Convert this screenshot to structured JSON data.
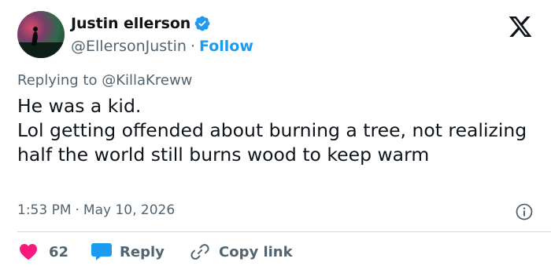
{
  "author": {
    "display_name": "Justin ellerson",
    "handle": "@EllersonJustin",
    "separator": "·",
    "follow_label": "Follow"
  },
  "reply": {
    "prefix": "Replying to",
    "mention": "@KillaKreww"
  },
  "tweet": {
    "line1": "He was a kid.",
    "line2": "Lol getting offended about burning a tree, not realizing half the world still burns wood to keep warm"
  },
  "meta": {
    "time": "1:53 PM",
    "separator": "·",
    "date": "May 10, 2026"
  },
  "actions": {
    "likes": "62",
    "reply_label": "Reply",
    "copy_label": "Copy link"
  },
  "colors": {
    "accent": "#1d9bf0",
    "like": "#f91880",
    "text": "#0f1419",
    "muted": "#536471"
  },
  "icons": [
    "verified-badge-icon",
    "x-logo-icon",
    "info-icon",
    "heart-icon",
    "reply-bubble-icon",
    "link-icon"
  ]
}
